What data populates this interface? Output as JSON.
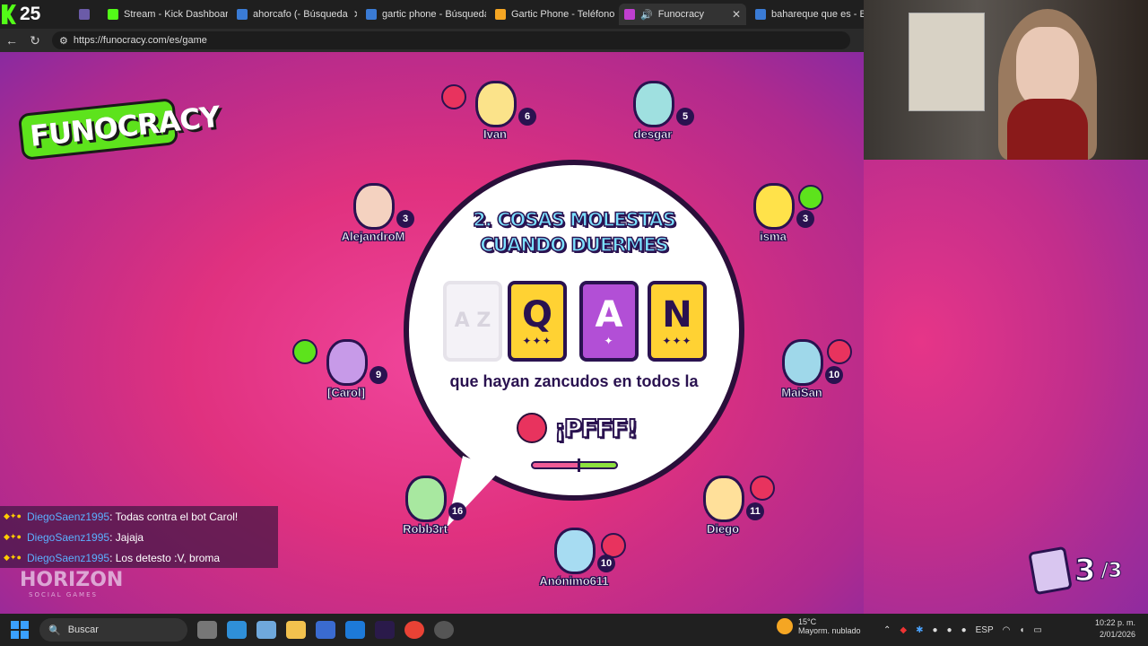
{
  "kick_counter": "25",
  "tabs": [
    {
      "label": "",
      "color": "#6b5ba8"
    },
    {
      "label": "Stream - Kick Dashboard",
      "color": "#53fc18"
    },
    {
      "label": "ahorcafo (- Búsqueda",
      "color": "#3a7bd5"
    },
    {
      "label": "gartic phone - Búsqueda",
      "color": "#3a7bd5"
    },
    {
      "label": "Gartic Phone - Teléfono D",
      "color": "#f5a623"
    },
    {
      "label": "Funocracy",
      "color": "#c03fd0"
    },
    {
      "label": "bahareque que es - Búsq",
      "color": "#3a7bd5"
    }
  ],
  "address": {
    "url": "https://funocracy.com/es/game"
  },
  "game": {
    "logo": "FUNOCRACY",
    "prompt": "2. COSAS MOLESTAS CUANDO DUERMES",
    "cards": [
      {
        "letter": "A Z",
        "stars": "",
        "bg": "#e8e4ee"
      },
      {
        "letter": "Q",
        "stars": "✦✦✦",
        "bg": "#ffd233"
      },
      {
        "letter": "A",
        "stars": "✦",
        "bg": "#b24fd6"
      },
      {
        "letter": "N",
        "stars": "✦✦✦",
        "bg": "#ffd233"
      }
    ],
    "answer": "que hayan zancudos en todos la",
    "reaction": "¡PFFF!",
    "players": [
      {
        "name": "Ivan",
        "score": "6",
        "color": "#fbe38a"
      },
      {
        "name": "desgar",
        "score": "5",
        "color": "#9fe0e0"
      },
      {
        "name": "AlejandroM",
        "score": "3",
        "color": "#f4d2c0"
      },
      {
        "name": "isma",
        "score": "3",
        "color": "#ffe24a"
      },
      {
        "name": "[Carol]",
        "score": "9",
        "color": "#c79ae8"
      },
      {
        "name": "MaiSan",
        "score": "10",
        "color": "#9fd8ea"
      },
      {
        "name": "Robb3rt",
        "score": "16",
        "color": "#a8e8a0"
      },
      {
        "name": "Diego",
        "score": "11",
        "color": "#ffe09a"
      },
      {
        "name": "Anónimo611",
        "score": "10",
        "color": "#a7dcf2"
      }
    ],
    "round_current": "3",
    "round_total": "/3",
    "brand": "HORIZON",
    "brand_sub": "SOCIAL GAMES"
  },
  "chat": [
    {
      "user": "DiegoSaenz1995",
      "msg": ": Todas contra el bot Carol!"
    },
    {
      "user": "DiegoSaenz1995",
      "msg": ": Jajaja"
    },
    {
      "user": "DiegoSaenz1995",
      "msg": ": Los detesto :V, broma"
    }
  ],
  "taskbar": {
    "search": "Buscar",
    "temp": "15°C",
    "weather": "Mayorm. nublado",
    "lang": "ESP",
    "time": "10:22 p. m.",
    "date": "2/01/2026"
  }
}
